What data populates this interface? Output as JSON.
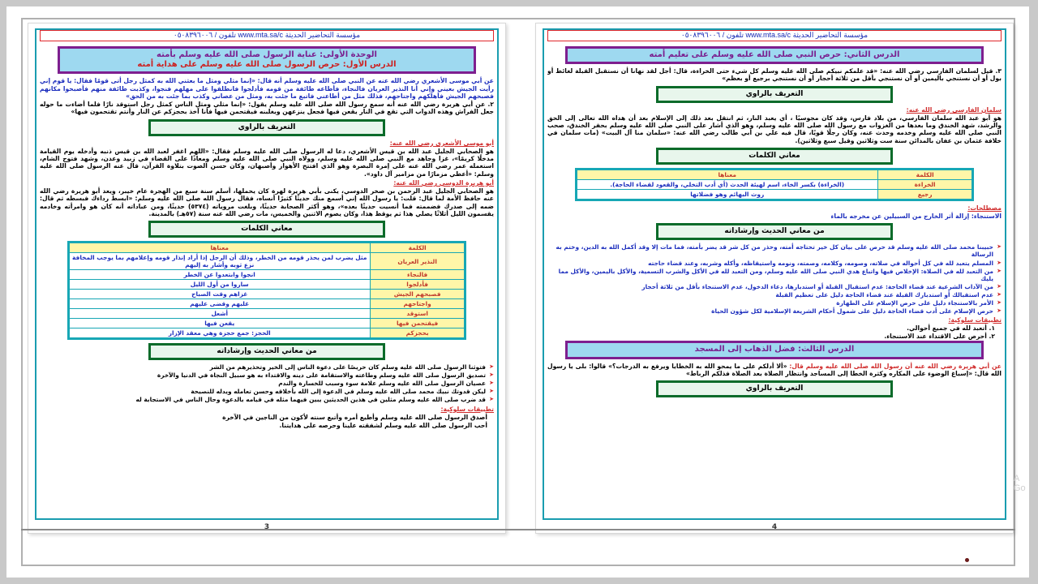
{
  "header": {
    "text": "تلفون / ٠٥٠٨٣٩٦٠٠٦ www.mta.sa/c مؤسسة التحاضير الحديثة"
  },
  "left_page": {
    "unit_title": "الوحدة الأولى: عناية الرسول صلى الله عليه وسلم بأمته",
    "lesson_title": "الدرس الأول: حرص الرسول صلى الله عليه وسلم على هداية أمته",
    "hadith1": "عن أبي موسى الأشعري رضي الله عنه عن النبي صلى الله عليه وسلم أنه قال: «إنما مثلي ومثل ما بعثني الله به كمثل رجل أتى قومًا فقال: يا قوم إني رأيت الجيش بعيني وإني أنا النذير العريان فالنجاء، فأطاعه طائفة من قومه فأدلجوا فانطلقوا على مهلهم فنجوا، وكذبت طائفة منهم فأصبحوا مكانهم فصبحهم الجيش فأهلكهم واجتاحهم، فذلك مثل من أطاعني فاتبع ما جئت به، ومثل من عصاني وكذب بما جئت به من الحق»",
    "hadith2": "٢. عن أبي هريرة رضي الله عنه أنه سمع رسول الله صلى الله عليه وسلم يقول: «إنما مثلي ومثل الناس كمثل رجل استوقد نارًا فلما أضاءت ما حوله جعل الفراش وهذه الدواب التي تقع في النار يقعن فيها فجعل ينزعهن ويغلبنه فيقتحمن فيها فأنا آخذ بحجزكم عن النار وأنتم تقتحمون فيها»",
    "section_narrator": "التعريف بالراوي",
    "narrator1_name": "أبو موسى الأشعري رضي الله عنه:",
    "narrator1_text": "هو الصحابي الجليل عبد الله بن قيس الأشعري، دعا له الرسول صلى الله عليه وسلم فقال: «اللهم اغفر لعبد الله بن قيس ذنبه وأدخله يوم القيامة مدخلًا كريمًا»، غزا وجاهد مع النبي صلى الله عليه وسلم، وولاه النبي صلى الله عليه وسلم ومعاذًا على القضاء في زبيد وعدن، وشهد فتوح الشام، استعمله عمر رضي الله عنه على إمرة البصرة وهو الذي افتتح الأهواز وأصبهان، وكان حسن الصوت بتلاوة القرآن، قال عنه الرسول صلى الله عليه وسلم: «أعطي مزمارًا من مزامير آل داود».",
    "narrator2_name": "أبو هريرة الدوسي رضي الله عنه:",
    "narrator2_text": "هو الصحابي الجليل عبد الرحمن بن صخر الدوسي، يكنى بأبي هريرة لهرة كان يحملها، أسلم سنة سبع من الهجرة عام خيبر، ويعد أبو هريرة رضي الله عنه حافظ الأمة لما قال: قلت: يا رسول الله إني أسمع منك حديثًا كثيرًا أنساه، فقال رسول الله صلى الله عليه وسلم: «ابسط رداءك فبسطه ثم قال: ضمه إلى صدرك فضممته فما أنسيت حديثًا بعده»، وهو أكثر الصحابة حديثًا، وبلغت مروياته (٥٣٧٤) حديثًا، ومن عباداته أنه كان هو وامرأته وخادمه يقسمون الليل أثلاثًا يصلي هذا ثم يوقظ هذا، وكان يصوم الاثنين والخميس، مات رضي الله عنه سنة (٥٧هـ) بالمدينة.",
    "section_words": "معاني الكلمات",
    "words_headers": {
      "word": "الكلمة",
      "meaning": "معناها"
    },
    "words": [
      {
        "word": "النذير العريان",
        "meaning": "مثل يضرب لمن يحذر قومه من الخطر، وذلك أن الرجل إذا أراد إنذار قومه وإعلامهم بما يوجب المخافة نزع ثوبه وأشار به إليهم"
      },
      {
        "word": "فالنجاء",
        "meaning": "انجوا وابتعدوا عن الخطر"
      },
      {
        "word": "فأدلجوا",
        "meaning": "ساروا من أول الليل"
      },
      {
        "word": "فصبحهم الجيش",
        "meaning": "غزاهم وقت الصباح"
      },
      {
        "word": "واجتاحهم",
        "meaning": "غلبهم وقضى عليهم"
      },
      {
        "word": "استوقد",
        "meaning": "أشعل"
      },
      {
        "word": "فيقتحمن فيها",
        "meaning": "يقعن فيها"
      },
      {
        "word": "بحجزكم",
        "meaning": "الحجز: جمع حجزة وهي معقد الإزار"
      }
    ],
    "section_guidance": "من معاني الحديث وإرشاداته",
    "guidance": [
      "فتوثنا الرسول صلى الله عليه وسلم كان حريصًا على دعوة الناس إلى الخير وتحذيرهم من الشر",
      "تصديق الرسول صلى الله عليه وسلم وطاعته والاستقامة على دينه والاقتداء به هو سبيل النجاة في الدنيا والآخرة",
      "عصيان الرسول صلى الله عليه وسلم علامة سوء وسبب للخسارة والندم",
      "ليكن قدوتك نبيك محمد صلى الله عليه وسلم في الدعوة إلى الله بأخلاقه وحسن تعامله ويدله للنصيحة",
      "قد ضرب صلى الله عليه وسلم مثلين في هذين الحديثين يبين فيهما مثله في قيامه بالدعوة وحال الناس في الاستجابة له"
    ],
    "behavior_title": "تطبيقات سلوكية:",
    "behavior": [
      "أصدق الرسول صلى الله عليه وسلم وأطيع أمره وأتبع سنته لأكون من الناجين في الآخرة",
      "أحب الرسول صلى الله عليه وسلم لشفقته علينا وحرصه على هدايتنا."
    ],
    "page_number": "3"
  },
  "right_page": {
    "lesson_title": "الدرس الثاني: حرص النبي صلى الله عليه وسلم على تعليم أمته",
    "hadith": "٣. قيل لسلمان الفارسي رضي الله عنه: «قد علمكم نبيكم صلى الله عليه وسلم كل شيء حتى الخراءة، قال: أجل لقد نهانا أن نستقبل القبلة لغائط أو بول أو أن نستنجي باليمين أو أن نستنجي بأقل من ثلاثة أحجار أو أن نستنجي برجيع أو بعظم»",
    "section_narrator": "التعريف بالراوي",
    "narrator_name": "سلمان الفارسي رضي الله عنه:",
    "narrator_text": "هو أبو عبد الله سلمان الفارسي، من بلاد فارس، وقد كان مجوسيًا ، أي يعبد النار، ثم انتقل بعد ذلك إلى الإسلام بعد أن هداه الله تعالى إلى الحق والرشد، شهد الخندق وما بعدها من الغزوات مع رسول الله صلى الله عليه وسلم، وهو الذي أشار على النبي صلى الله عليه وسلم بحفر الخندق، صحب النبي صلى الله عليه وسلم وخدمه وحدث عنه، وكان رجلًا قويًا، قال فيه علي بن أبي طالب رضي الله عنه: «سلمان منا آل البيت» (مات سلمان في خلافة عثمان بن عفان بالمدائن سنة ست وثلاثين وقيل سبع وثلاثين).",
    "section_words": "معاني الكلمات",
    "words_headers": {
      "word": "الكلمة",
      "meaning": "معناها"
    },
    "words": [
      {
        "word": "الخراءة",
        "meaning": "(الخراءة) بكسر الخاء، اسم لهيئة الحدث (أي أدب التخلي، والقعود لقضاء الحاجة)."
      },
      {
        "word": "رجيع",
        "meaning": "روث البهائم وهو فضلاتها"
      }
    ],
    "terms_title": "مصطلحات:",
    "terms_text": "الاستنجاء: إزالة أثر الخارج من السبيلين عن مخرجه بالماء",
    "section_guidance": "من معاني الحديث وإرشاداته",
    "guidance": [
      "حبيبنا محمد صلى الله عليه وسلم قد حرص على بيان كل خير تحتاجه أمته، وحذر من كل شر قد يضر بأمته، فما مات إلا وقد أكمل الله به الدين، وختم به الرسالة",
      "المسلم يتعبد لله في كل أحواله في صلاته، وصومه، وكلامه، وصمته، ونومه واستيقاظه، وأكله وشربه، وعند قضاء حاجته",
      "من التعبد لله في الصلاة: الإخلاص فيها واتباع هدي النبي صلى الله عليه وسلم، ومن التعبد لله في الأكل والشرب التسمية، والأكل باليمين، والأكل مما يليك",
      "من الآداب الشرعية عند قضاء الحاجة: عدم استقبال القبلة أو استدبارها، دعاء الدخول، عدم الاستنجاء بأقل من ثلاثة أحجار",
      "عدم استقبالك أو استدبارك القبلة عند قضاء الحاجة دليل على تعظيم القبلة",
      "الأمر بالاستنجاء دليل على حرص الإسلام على الطهارة",
      "حرص الإسلام على أدب قضاء الحاجة دليل على شمول أحكام الشريعة الإسلامية لكل شؤون الحياة"
    ],
    "behavior_title": "تطبيقات سلوكية:",
    "behavior": [
      "١. أتعبد لله في جميع أحوالي.",
      "٢. أحرص على الاقتداء عند الاستنجاء."
    ],
    "lesson3_title": "الدرس الثالث: فضل الذهاب إلى المسجد",
    "hadith3_intro": "عن أبي هريرة رضي الله عنه أن رسول الله صلى الله عليه وسلم قال:",
    "hadith3": "«ألا أدلكم على ما يمحو الله به الخطايا ويرفع به الدرجات؟» قالوا: بلى يا رسول الله قال: «إسباغ الوضوء على المكاره وكثرة الخطا إلى المساجد وانتظار الصلاة بعد الصلاة فذلكم الرباط»",
    "section_narrator2": "التعريف بالراوي",
    "page_number": "4"
  },
  "watermark": {
    "line1": "A",
    "line2": "Go"
  },
  "colors": {
    "frame_border": "#1a9db0",
    "header_red": "#e0262a",
    "lesson_purple": "#7e1f8f",
    "section_green": "#0b6b2a"
  }
}
